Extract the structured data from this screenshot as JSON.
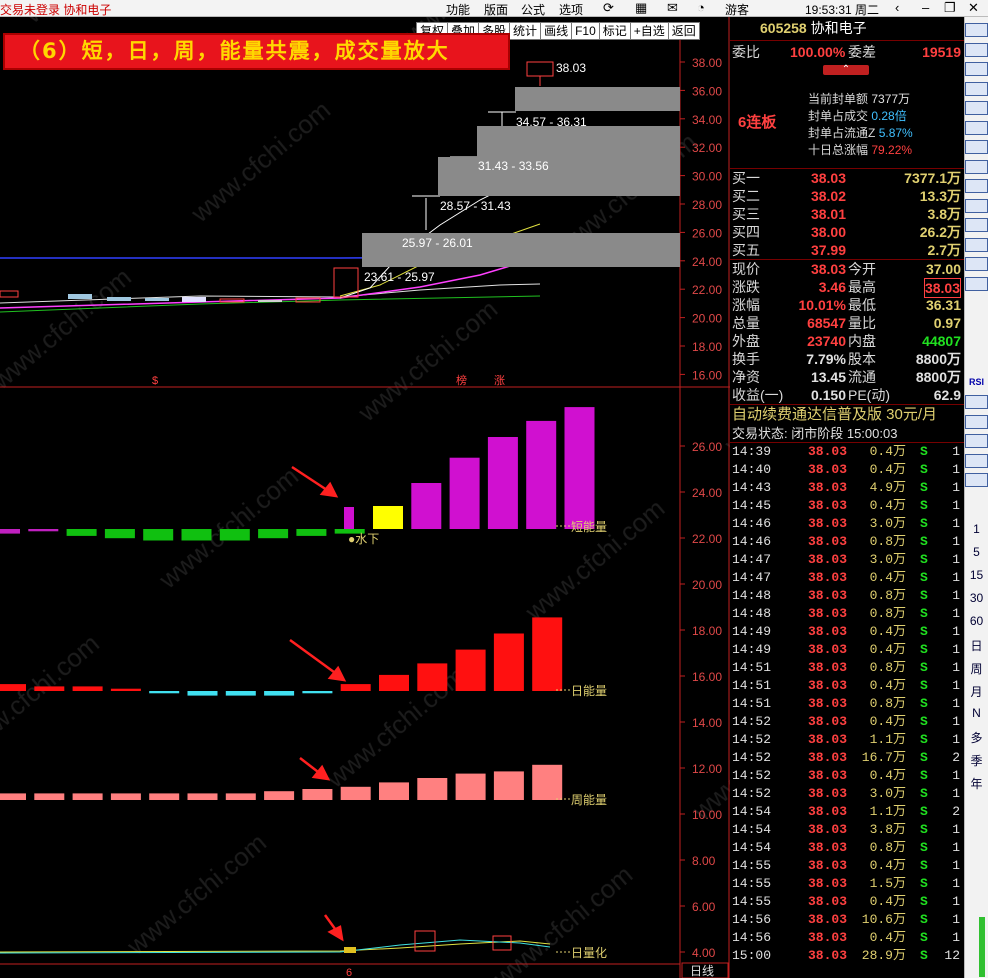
{
  "window": {
    "title": "交易未登录  协和电子",
    "menus": [
      "功能",
      "版面",
      "公式",
      "选项"
    ],
    "user": "游客",
    "clock": "19:53:31 周二"
  },
  "toolbar": {
    "buttons": [
      "复权",
      "叠加",
      "多股",
      "统计",
      "画线",
      "F10",
      "标记",
      "+自选",
      "返回"
    ]
  },
  "banner": {
    "text": "（6）短，日，周，能量共震，成交量放大"
  },
  "main_chart": {
    "price_axis": [
      "38.00",
      "36.00",
      "34.00",
      "32.00",
      "30.00",
      "28.00",
      "26.00",
      "24.00",
      "22.00",
      "20.00",
      "18.00",
      "16.00"
    ],
    "high_label": "38.03",
    "gap_labels": [
      "34.57 - 36.31",
      "31.43 - 33.56",
      "28.57 - 31.43",
      "25.97 - 26.01",
      "23.61 - 25.97"
    ],
    "markers": [
      "$",
      "榜",
      "涨"
    ]
  },
  "indicator_chart": {
    "axis": [
      "26.00",
      "24.00",
      "22.00",
      "20.00",
      "18.00",
      "16.00",
      "14.00",
      "12.00",
      "10.00",
      "8.00",
      "6.00",
      "4.00"
    ],
    "labels": {
      "short": "短能量",
      "day": "日能量",
      "week": "周能量",
      "vol": "日量化",
      "water": "●水下"
    },
    "bottom_tag": "日线",
    "date_mark": "6"
  },
  "chart_data": [
    {
      "type": "bar",
      "title": "短能量",
      "series": [
        {
          "values": [
            -0.2,
            -0.1,
            -0.3,
            -0.4,
            -0.5,
            -0.5,
            -0.5,
            -0.4,
            -0.3,
            -0.2,
            1.0,
            2.0,
            3.1,
            4.0,
            4.7,
            5.3
          ]
        }
      ]
    },
    {
      "type": "bar",
      "title": "日能量",
      "series": [
        {
          "values": [
            0.3,
            0.2,
            0.2,
            0.1,
            -0.1,
            -0.2,
            -0.2,
            -0.2,
            -0.1,
            0.3,
            0.7,
            1.2,
            1.8,
            2.5,
            3.2
          ]
        }
      ]
    },
    {
      "type": "bar",
      "title": "周能量",
      "series": [
        {
          "values": [
            0.3,
            0.3,
            0.3,
            0.3,
            0.3,
            0.3,
            0.3,
            0.4,
            0.5,
            0.6,
            0.8,
            1.0,
            1.2,
            1.3,
            1.6
          ]
        }
      ]
    }
  ],
  "quote": {
    "code": "605258",
    "name": "协和电子",
    "webi": {
      "label1": "委比",
      "val1": "100.00%",
      "label2": "委差",
      "val2": "19519"
    },
    "lianban": "6连板",
    "seal": [
      {
        "k": "当前封单额",
        "v": "7377万"
      },
      {
        "k": "封单占成交",
        "v": "0.28倍"
      },
      {
        "k": "封单占流通Z",
        "v": "5.87%"
      },
      {
        "k": "十日总涨幅",
        "v": "79.22%"
      }
    ],
    "bids": [
      {
        "k": "买一",
        "p": "38.03",
        "v": "7377.1万"
      },
      {
        "k": "买二",
        "p": "38.02",
        "v": "13.3万"
      },
      {
        "k": "买三",
        "p": "38.01",
        "v": "3.8万"
      },
      {
        "k": "买四",
        "p": "38.00",
        "v": "26.2万"
      },
      {
        "k": "买五",
        "p": "37.99",
        "v": "2.7万"
      }
    ],
    "stats": [
      {
        "k1": "现价",
        "v1": "38.03",
        "k2": "今开",
        "v2": "37.00"
      },
      {
        "k1": "涨跌",
        "v1": "3.46",
        "k2": "最高",
        "v2": "38.03"
      },
      {
        "k1": "涨幅",
        "v1": "10.01%",
        "k2": "最低",
        "v2": "36.31"
      },
      {
        "k1": "总量",
        "v1": "68547",
        "k2": "量比",
        "v2": "0.97"
      },
      {
        "k1": "外盘",
        "v1": "23740",
        "k2": "内盘",
        "v2": "44807"
      },
      {
        "k1": "换手",
        "v1": "7.79%",
        "k2": "股本",
        "v2": "8800万"
      },
      {
        "k1": "净资",
        "v1": "13.45",
        "k2": "流通",
        "v2": "8800万"
      },
      {
        "k1": "收益(一)",
        "v1": "0.150",
        "k2": "PE(动)",
        "v2": "62.9"
      }
    ],
    "ad": "自动续费通达信普及版 30元/月",
    "status": "交易状态: 闭市阶段 15:00:03",
    "ticks": [
      [
        "14:39",
        "38.03",
        "0.4万",
        "S",
        "1"
      ],
      [
        "14:40",
        "38.03",
        "0.4万",
        "S",
        "1"
      ],
      [
        "14:43",
        "38.03",
        "4.9万",
        "S",
        "1"
      ],
      [
        "14:45",
        "38.03",
        "0.4万",
        "S",
        "1"
      ],
      [
        "14:46",
        "38.03",
        "3.0万",
        "S",
        "1"
      ],
      [
        "14:46",
        "38.03",
        "0.8万",
        "S",
        "1"
      ],
      [
        "14:47",
        "38.03",
        "3.0万",
        "S",
        "1"
      ],
      [
        "14:47",
        "38.03",
        "0.4万",
        "S",
        "1"
      ],
      [
        "14:48",
        "38.03",
        "0.8万",
        "S",
        "1"
      ],
      [
        "14:48",
        "38.03",
        "0.8万",
        "S",
        "1"
      ],
      [
        "14:49",
        "38.03",
        "0.4万",
        "S",
        "1"
      ],
      [
        "14:49",
        "38.03",
        "0.4万",
        "S",
        "1"
      ],
      [
        "14:51",
        "38.03",
        "0.8万",
        "S",
        "1"
      ],
      [
        "14:51",
        "38.03",
        "0.4万",
        "S",
        "1"
      ],
      [
        "14:51",
        "38.03",
        "0.8万",
        "S",
        "1"
      ],
      [
        "14:52",
        "38.03",
        "0.4万",
        "S",
        "1"
      ],
      [
        "14:52",
        "38.03",
        "1.1万",
        "S",
        "1"
      ],
      [
        "14:52",
        "38.03",
        "16.7万",
        "S",
        "2"
      ],
      [
        "14:52",
        "38.03",
        "0.4万",
        "S",
        "1"
      ],
      [
        "14:52",
        "38.03",
        "3.0万",
        "S",
        "1"
      ],
      [
        "14:54",
        "38.03",
        "1.1万",
        "S",
        "2"
      ],
      [
        "14:54",
        "38.03",
        "3.8万",
        "S",
        "1"
      ],
      [
        "14:54",
        "38.03",
        "0.8万",
        "S",
        "1"
      ],
      [
        "14:55",
        "38.03",
        "0.4万",
        "S",
        "1"
      ],
      [
        "14:55",
        "38.03",
        "1.5万",
        "S",
        "1"
      ],
      [
        "14:55",
        "38.03",
        "0.4万",
        "S",
        "1"
      ],
      [
        "14:56",
        "38.03",
        "10.6万",
        "S",
        "1"
      ],
      [
        "14:56",
        "38.03",
        "0.4万",
        "S",
        "1"
      ],
      [
        "15:00",
        "38.03",
        "28.9万",
        "S",
        "12"
      ]
    ]
  },
  "sidebar": {
    "periods": [
      "1",
      "5",
      "15",
      "30",
      "60",
      "日",
      "周",
      "月",
      "N",
      "多",
      "季",
      "年"
    ],
    "rsi": "RSI"
  }
}
